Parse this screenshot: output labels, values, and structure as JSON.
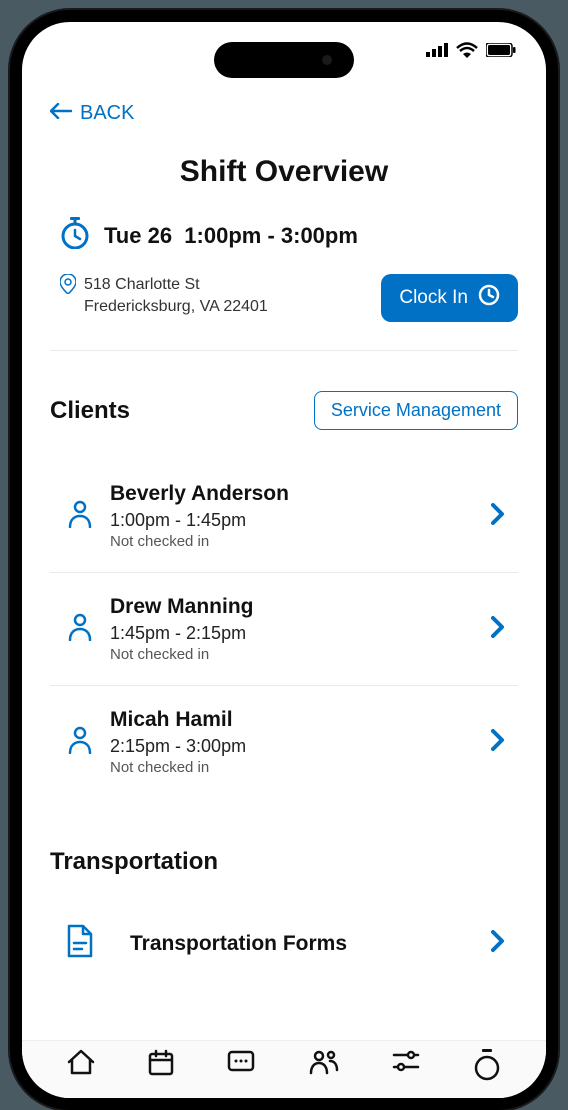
{
  "colors": {
    "primary": "#0071c5",
    "text": "#111"
  },
  "header": {
    "back_label": "BACK",
    "title": "Shift Overview"
  },
  "shift": {
    "day_label": "Tue 26",
    "time_range": "1:00pm - 3:00pm",
    "address_line1": "518 Charlotte St",
    "address_line2": "Fredericksburg, VA 22401",
    "clock_in_label": "Clock In"
  },
  "clients": {
    "title": "Clients",
    "service_mgmt_label": "Service Management",
    "items": [
      {
        "name": "Beverly Anderson",
        "time": "1:00pm - 1:45pm",
        "status": "Not checked in"
      },
      {
        "name": "Drew Manning",
        "time": "1:45pm - 2:15pm",
        "status": "Not checked in"
      },
      {
        "name": "Micah Hamil",
        "time": "2:15pm - 3:00pm",
        "status": "Not checked in"
      }
    ]
  },
  "transportation": {
    "title": "Transportation",
    "forms_label": "Transportation Forms"
  }
}
